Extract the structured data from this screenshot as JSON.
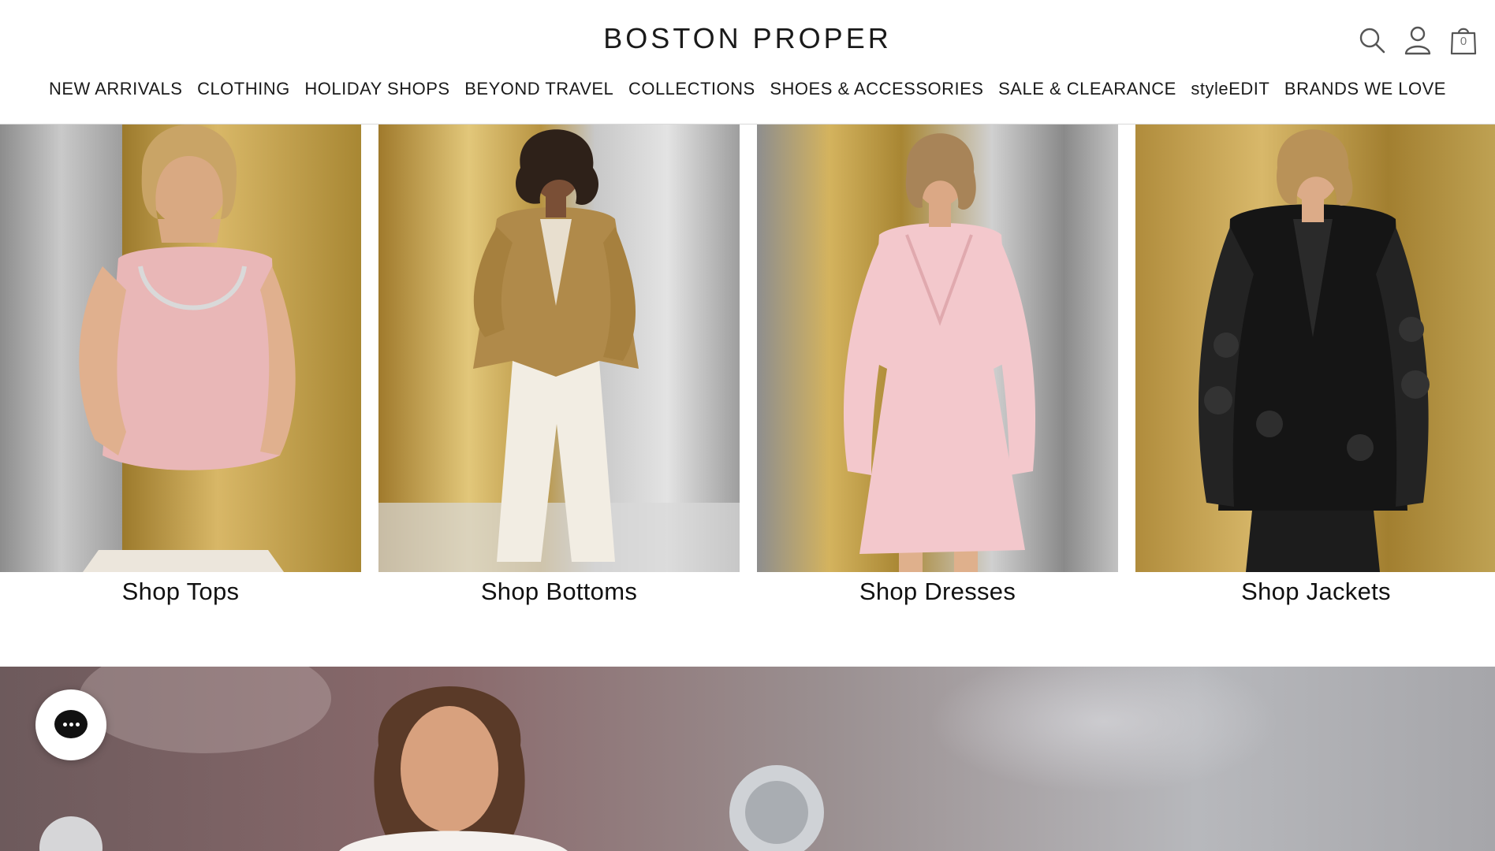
{
  "header": {
    "logo_text": "BOSTON PROPER",
    "icons": {
      "search": "search-icon",
      "account": "user-icon",
      "cart": "shopping-bag-icon"
    },
    "cart_count": "0"
  },
  "nav": {
    "items": [
      {
        "label": "NEW ARRIVALS"
      },
      {
        "label": "CLOTHING"
      },
      {
        "label": "HOLIDAY SHOPS"
      },
      {
        "label": "BEYOND TRAVEL"
      },
      {
        "label": "COLLECTIONS"
      },
      {
        "label": "SHOES & ACCESSORIES"
      },
      {
        "label": "SALE & CLEARANCE"
      },
      {
        "label": "styleEDIT"
      },
      {
        "label": "BRANDS WE LOVE"
      }
    ]
  },
  "tiles": [
    {
      "label": "Shop Tops"
    },
    {
      "label": "Shop Bottoms"
    },
    {
      "label": "Shop Dresses"
    },
    {
      "label": "Shop Jackets"
    }
  ],
  "chat": {
    "icon": "chat-bubble-icon"
  },
  "colors": {
    "text": "#1a1a1a",
    "divider": "#d9d9d9",
    "gold": "#c9a24a",
    "silver": "#b8b8b8"
  }
}
